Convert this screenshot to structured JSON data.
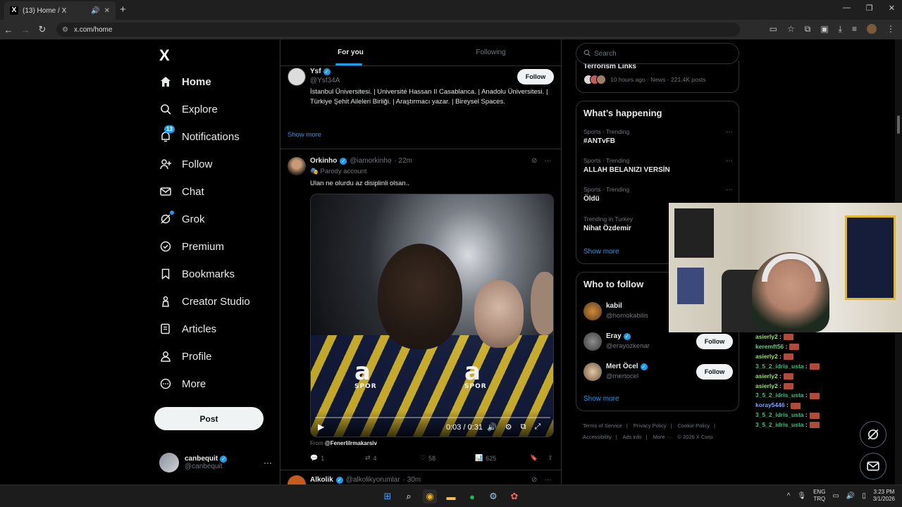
{
  "browser": {
    "tab_title": "(13) Home / X",
    "url": "x.com/home"
  },
  "nav": {
    "logo": "X",
    "items": [
      {
        "label": "Home",
        "icon": "home-icon"
      },
      {
        "label": "Explore",
        "icon": "search-icon"
      },
      {
        "label": "Notifications",
        "icon": "bell-icon",
        "badge": "13"
      },
      {
        "label": "Follow",
        "icon": "person-add-icon"
      },
      {
        "label": "Chat",
        "icon": "mail-icon"
      },
      {
        "label": "Grok",
        "icon": "grok-icon"
      },
      {
        "label": "Premium",
        "icon": "verified-icon"
      },
      {
        "label": "Bookmarks",
        "icon": "bookmark-icon"
      },
      {
        "label": "Creator Studio",
        "icon": "creator-icon"
      },
      {
        "label": "Articles",
        "icon": "articles-icon"
      },
      {
        "label": "Profile",
        "icon": "profile-icon"
      },
      {
        "label": "More",
        "icon": "more-circle-icon"
      }
    ],
    "post_label": "Post",
    "account": {
      "name": "canbequit",
      "handle": "@canbequit"
    }
  },
  "feed": {
    "tabs": [
      "For you",
      "Following"
    ],
    "profile_card": {
      "name": "Ysf",
      "handle": "@Ysf34A",
      "follow_label": "Follow",
      "bio": "İstanbul Üniversitesi. | Université Hassan II Casablanca. | Anadolu Üniversitesi. | Türkiye Şehit Aileleri Birliği. | Araştırmacı yazar. | Bireysel Spaces.",
      "show_more": "Show more"
    },
    "tweet": {
      "name": "Orkinho",
      "handle": "@iamorkinho",
      "time": "· 22m",
      "parody": "Parody account",
      "text": "Ulan ne olurdu az disiplinli olsan..",
      "video_time": "0:03 / 0:31",
      "sponsor": "a",
      "sponsor_sub": "SPOR",
      "from_prefix": "From",
      "from_account": "@Fenerlilrmakarsiv",
      "replies": "1",
      "reposts": "4",
      "likes": "58",
      "views": "625"
    },
    "tweet2": {
      "name": "Alkolik",
      "handle": "@alkolikyorumlar",
      "time": "· 30m"
    }
  },
  "right": {
    "search_placeholder": "Search",
    "trend_top": {
      "title": "Terrorism Links",
      "meta": "10 hours ago · News · 221.4K posts"
    },
    "happening": {
      "title": "What’s happening",
      "trends": [
        {
          "category": "Sports · Trending",
          "name": "#ANTvFB"
        },
        {
          "category": "Sports · Trending",
          "name": "ALLAH BELANIZI VERSİN"
        },
        {
          "category": "Sports · Trending",
          "name": "Öldü"
        },
        {
          "category": "Trending in Turkey",
          "name": "Nihat Özdemir"
        }
      ],
      "show_more": "Show more"
    },
    "who_to_follow": {
      "title": "Who to follow",
      "people": [
        {
          "name": "kabil",
          "handle": "@homokabilis",
          "verified": false,
          "follow": ""
        },
        {
          "name": "Eray",
          "handle": "@erayozkenar",
          "verified": true,
          "follow": "Follow"
        },
        {
          "name": "Mert Öcel",
          "handle": "@mertocel",
          "verified": true,
          "follow": "Follow"
        }
      ],
      "show_more": "Show more"
    },
    "footer": [
      "Terms of Service",
      "|",
      "Privacy Policy",
      "|",
      "Cookie Policy",
      "|",
      "Accessibility",
      "|",
      "Ads info",
      "|",
      "More ···",
      "© 2026 X Corp."
    ]
  },
  "chat": [
    {
      "user": "asierly2",
      "color": "#9be36b"
    },
    {
      "user": "keremft56",
      "color": "#6bd07a"
    },
    {
      "user": "asierly2",
      "color": "#9be36b"
    },
    {
      "user": "3_5_2_idris_usta",
      "color": "#2ec27e"
    },
    {
      "user": "asierly2",
      "color": "#9be36b"
    },
    {
      "user": "asierly2",
      "color": "#9be36b"
    },
    {
      "user": "3_5_2_idris_usta",
      "color": "#2ec27e"
    },
    {
      "user": "koray5446",
      "color": "#7aa2ff"
    },
    {
      "user": "3_5_2_idris_usta",
      "color": "#2ec27e"
    },
    {
      "user": "3_5_2_idris_usta",
      "color": "#2ec27e"
    }
  ],
  "taskbar": {
    "lang_top": "ENG",
    "lang_bottom": "TRQ",
    "time": "3:23 PM",
    "date": "3/1/2026"
  },
  "colors": {
    "accent": "#1d9bf0",
    "background": "#000000",
    "border": "#2f3336",
    "muted": "#71767b"
  }
}
